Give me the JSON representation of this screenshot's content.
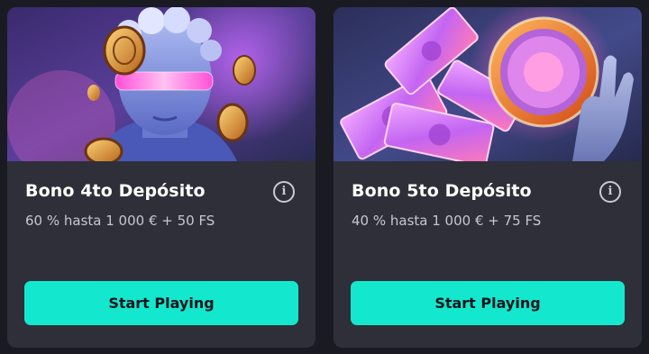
{
  "cards": [
    {
      "title": "Bono 4to Depósito",
      "offer": "60 % hasta 1 000 € + 50 FS",
      "cta_label": "Start Playing",
      "info_glyph": "i",
      "image_icon": "statue-vr-coins-art"
    },
    {
      "title": "Bono 5to Depósito",
      "offer": "40 % hasta 1 000 € + 75 FS",
      "cta_label": "Start Playing",
      "info_glyph": "i",
      "image_icon": "hand-money-wheel-art"
    }
  ],
  "colors": {
    "page_bg": "#1a1b22",
    "card_bg": "#2e2f38",
    "cta_bg": "#13e8cf",
    "cta_text": "#14151b",
    "title_text": "#ffffff",
    "offer_text": "#c6c7d0"
  }
}
